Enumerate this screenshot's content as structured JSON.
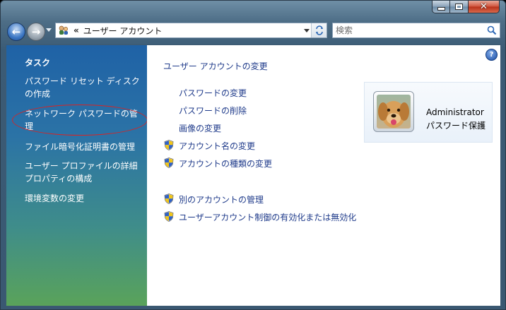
{
  "window": {
    "caption_close": "✕"
  },
  "address": {
    "chevron": "«",
    "path": "ユーザー アカウント"
  },
  "search": {
    "placeholder": "検索"
  },
  "sidebar": {
    "title": "タスク",
    "items": [
      {
        "label": "パスワード リセット ディスクの作成"
      },
      {
        "label": "ネットワーク パスワードの管理"
      },
      {
        "label": "ファイル暗号化証明書の管理"
      },
      {
        "label": "ユーザー プロファイルの詳細プロパティの構成"
      },
      {
        "label": "環境変数の変更"
      }
    ]
  },
  "main": {
    "heading": "ユーザー アカウントの変更",
    "links": [
      {
        "label": "パスワードの変更",
        "shield": false
      },
      {
        "label": "パスワードの削除",
        "shield": false
      },
      {
        "label": "画像の変更",
        "shield": false
      },
      {
        "label": "アカウント名の変更",
        "shield": true
      },
      {
        "label": "アカウントの種類の変更",
        "shield": true
      },
      {
        "label": "別のアカウントの管理",
        "shield": true
      },
      {
        "label": "ユーザーアカウント制御の有効化または無効化",
        "shield": true
      }
    ]
  },
  "account": {
    "name": "Administrator",
    "type": "パスワード保護"
  },
  "colors": {
    "link": "#1e3a8a",
    "highlight_ellipse": "#d82424"
  }
}
